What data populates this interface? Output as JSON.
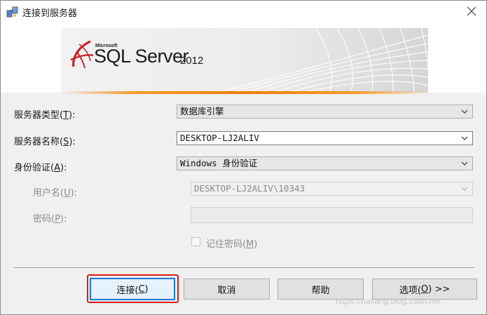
{
  "window": {
    "title": "连接到服务器",
    "close_icon": "close-icon"
  },
  "banner": {
    "microsoft": "Microsoft",
    "product": "SQL Server",
    "version": "2012"
  },
  "form": {
    "server_type": {
      "label": "服务器类型(",
      "key": "T",
      "suffix": "):",
      "value": "数据库引擎"
    },
    "server_name": {
      "label": "服务器名称(",
      "key": "S",
      "suffix": "):",
      "value": "DESKTOP-LJ2ALIV"
    },
    "auth": {
      "label": "身份验证(",
      "key": "A",
      "suffix": "):",
      "value": "Windows 身份验证"
    },
    "username": {
      "label": "用户名(",
      "key": "U",
      "suffix": "):",
      "value": "DESKTOP-LJ2ALIV\\10343",
      "disabled": true
    },
    "password": {
      "label": "密码(",
      "key": "P",
      "suffix": "):",
      "value": "",
      "disabled": true
    },
    "remember": {
      "label": "记住密码(",
      "key": "M",
      "suffix": ")",
      "checked": false,
      "disabled": true
    }
  },
  "buttons": {
    "connect": {
      "label": "连接(",
      "key": "C",
      "suffix": ")"
    },
    "cancel": {
      "label": "取消"
    },
    "help": {
      "label": "帮助"
    },
    "options": {
      "label": "选项(",
      "key": "O",
      "suffix": ") >>"
    }
  },
  "watermark": "https://haifang.blog.csdn.net"
}
